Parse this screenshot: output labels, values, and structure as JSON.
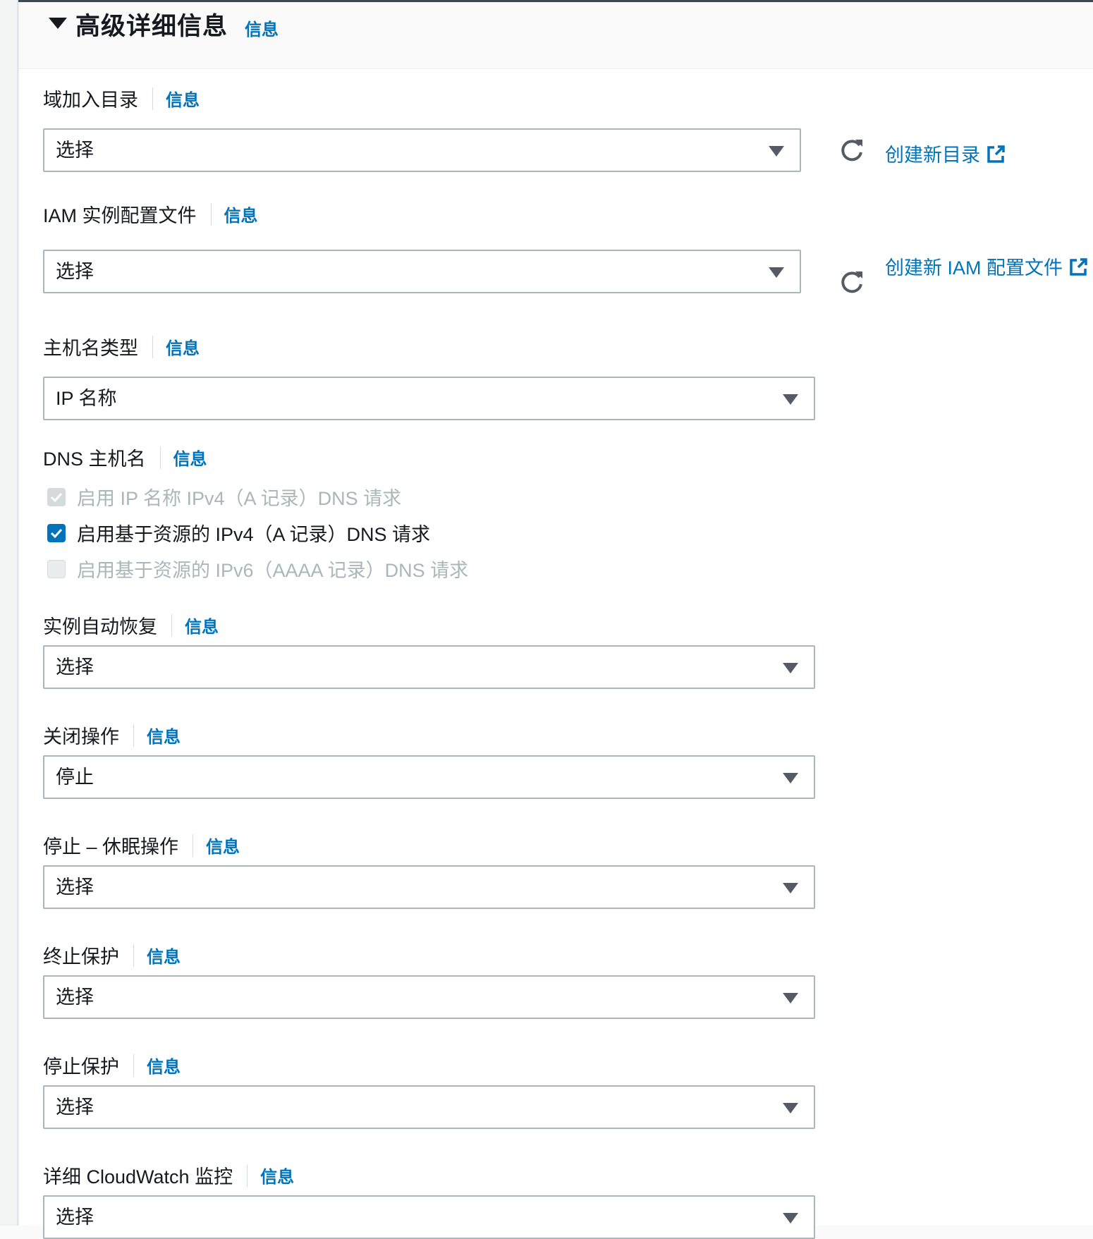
{
  "header": {
    "title": "高级详细信息",
    "info": "信息"
  },
  "fields": {
    "domain_join": {
      "label": "域加入目录",
      "info": "信息",
      "value": "选择",
      "link": "创建新目录"
    },
    "iam_profile": {
      "label": "IAM 实例配置文件",
      "info": "信息",
      "value": "选择",
      "link": "创建新 IAM 配置文件"
    },
    "hostname_type": {
      "label": "主机名类型",
      "info": "信息",
      "value": "IP 名称"
    },
    "dns_hostname": {
      "label": "DNS 主机名",
      "info": "信息",
      "options": [
        {
          "label": "启用 IP 名称 IPv4（A 记录）DNS 请求",
          "checked": true,
          "disabled": true
        },
        {
          "label": "启用基于资源的 IPv4（A 记录）DNS 请求",
          "checked": true,
          "disabled": false
        },
        {
          "label": "启用基于资源的 IPv6（AAAA 记录）DNS 请求",
          "checked": false,
          "disabled": true
        }
      ]
    },
    "auto_recovery": {
      "label": "实例自动恢复",
      "info": "信息",
      "value": "选择"
    },
    "shutdown_behavior": {
      "label": "关闭操作",
      "info": "信息",
      "value": "停止"
    },
    "stop_hibernate": {
      "label": "停止 – 休眠操作",
      "info": "信息",
      "value": "选择"
    },
    "termination_protection": {
      "label": "终止保护",
      "info": "信息",
      "value": "选择"
    },
    "stop_protection": {
      "label": "停止保护",
      "info": "信息",
      "value": "选择"
    },
    "cloudwatch": {
      "label": "详细 CloudWatch 监控",
      "info": "信息",
      "value": "选择"
    }
  },
  "colors": {
    "link": "#0073bb",
    "checkbox_checked": "#0073bb",
    "disabled_text": "#aab7b8"
  },
  "icons": [
    "caret-down-icon",
    "dropdown-arrow-icon",
    "refresh-icon",
    "external-link-icon",
    "checkmark-icon"
  ]
}
